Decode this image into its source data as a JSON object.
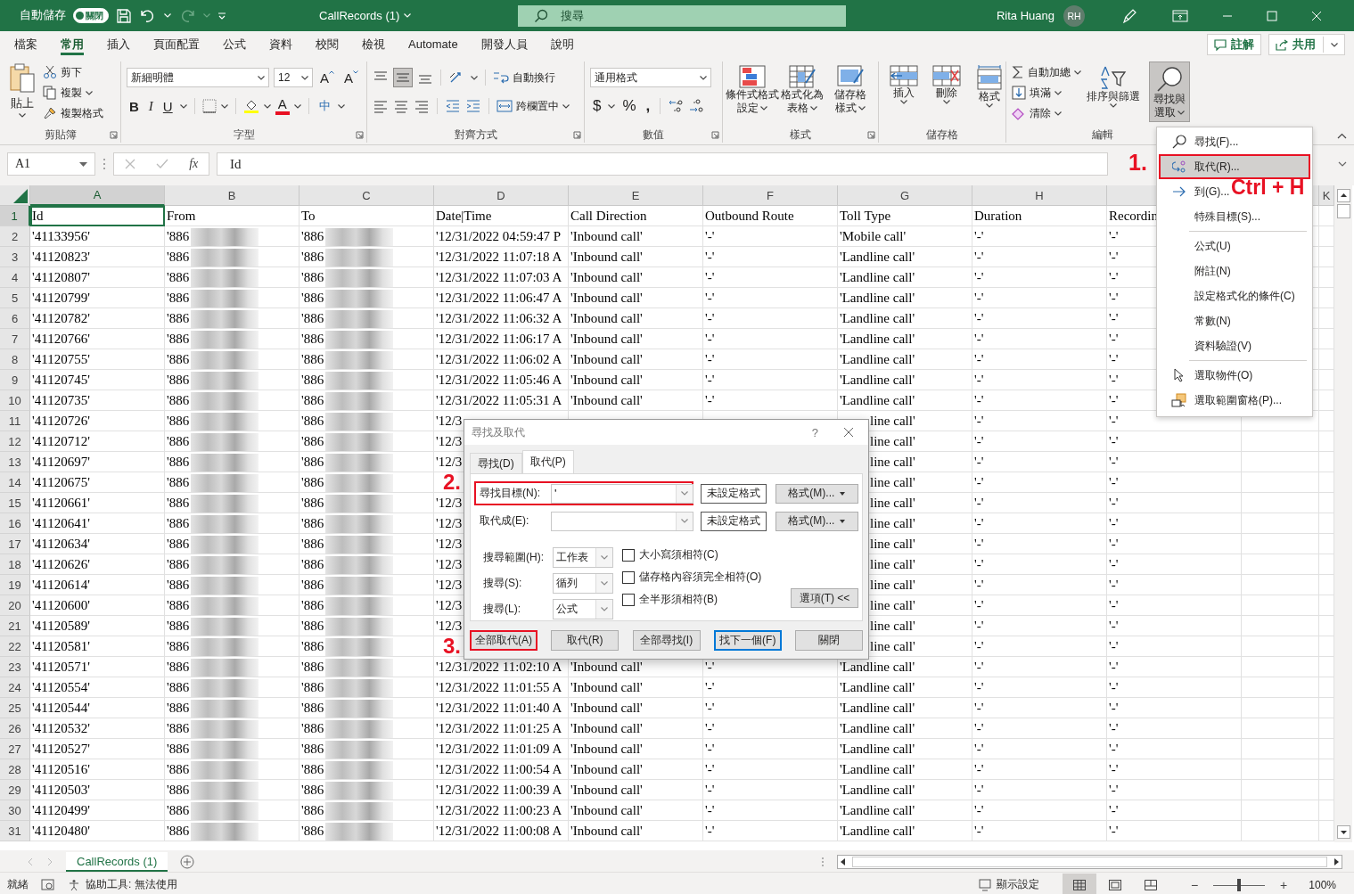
{
  "title_bar": {
    "autosave_label": "自動儲存",
    "autosave_on": false,
    "autosave_state": "關閉",
    "title": "CallRecords (1)",
    "search_placeholder": "搜尋",
    "user": "Rita Huang",
    "initials": "RH"
  },
  "ribbon_tabs": [
    {
      "label": "檔案",
      "selected": false
    },
    {
      "label": "常用",
      "selected": true
    },
    {
      "label": "插入",
      "selected": false
    },
    {
      "label": "頁面配置",
      "selected": false
    },
    {
      "label": "公式",
      "selected": false
    },
    {
      "label": "資料",
      "selected": false
    },
    {
      "label": "校閱",
      "selected": false
    },
    {
      "label": "檢視",
      "selected": false
    },
    {
      "label": "Automate",
      "selected": false
    },
    {
      "label": "開發人員",
      "selected": false
    },
    {
      "label": "說明",
      "selected": false
    }
  ],
  "comments_button": "註解",
  "share_button": "共用",
  "ribbon": {
    "clipboard": {
      "label": "剪貼簿",
      "paste": "貼上",
      "cut": "剪下",
      "copy": "複製",
      "format_painter": "複製格式"
    },
    "font": {
      "label": "字型",
      "font_name": "新細明體",
      "font_size": "12",
      "grow": "A",
      "shrink": "A",
      "bold": "B",
      "italic": "I",
      "underline": "U",
      "font_color": "A",
      "phonetic": "中"
    },
    "alignment": {
      "label": "對齊方式",
      "middle_aligned": true,
      "wrap_text": "自動換行",
      "merge_center": "跨欄置中"
    },
    "number": {
      "label": "數值",
      "format": "通用格式",
      "currency": "$",
      "percent": "%",
      "comma": ","
    },
    "styles": {
      "label": "樣式",
      "buttons": [
        {
          "kind": "conditional",
          "lines": [
            "條件式格式",
            "設定"
          ]
        },
        {
          "kind": "table",
          "lines": [
            "格式化為",
            "表格"
          ]
        },
        {
          "kind": "cellstyle",
          "lines": [
            "儲存格",
            "樣式"
          ]
        }
      ]
    },
    "cells": {
      "label": "儲存格",
      "buttons": [
        {
          "kind": "insert",
          "label": "插入"
        },
        {
          "kind": "delete",
          "label": "刪除"
        },
        {
          "kind": "format",
          "label": "格式"
        }
      ]
    },
    "editing": {
      "label": "編輯",
      "autosum": "自動加總",
      "fill": "填滿",
      "clear": "清除",
      "sort_filter": "排序與篩選",
      "find_select": [
        "尋找與",
        "選取"
      ],
      "find_select_pressed": true
    }
  },
  "sheet": {
    "name_box": "A1",
    "fx": "fx",
    "formula": "Id",
    "columns": [
      {
        "letter": "A",
        "selected": true
      },
      {
        "letter": "B",
        "selected": false
      },
      {
        "letter": "C",
        "selected": false
      },
      {
        "letter": "D",
        "selected": false
      },
      {
        "letter": "E",
        "selected": false
      },
      {
        "letter": "F",
        "selected": false
      },
      {
        "letter": "G",
        "selected": false
      },
      {
        "letter": "H",
        "selected": false
      }
    ],
    "last_column": "K",
    "rows": [
      {
        "n": "1",
        "selected": true,
        "cells": [
          "Id",
          "From",
          "To",
          "Date|Time",
          "Call Direction",
          "Outbound Route",
          "Toll Type",
          "Duration",
          "Recordin"
        ]
      },
      {
        "n": "2",
        "selected": false,
        "cells": [
          "'41133956'",
          "'886",
          "'886",
          "'12/31/2022 04:59:47 P",
          "'Inbound call'",
          "'-'",
          "'Mobile call'",
          "'-'",
          "'-'"
        ]
      },
      {
        "n": "3",
        "selected": false,
        "cells": [
          "'41120823'",
          "'886",
          "'886",
          "'12/31/2022 11:07:18 A",
          "'Inbound call'",
          "'-'",
          "'Landline call'",
          "'-'",
          "'-'"
        ]
      },
      {
        "n": "4",
        "selected": false,
        "cells": [
          "'41120807'",
          "'886",
          "'886",
          "'12/31/2022 11:07:03 A",
          "'Inbound call'",
          "'-'",
          "'Landline call'",
          "'-'",
          "'-'"
        ]
      },
      {
        "n": "5",
        "selected": false,
        "cells": [
          "'41120799'",
          "'886",
          "'886",
          "'12/31/2022 11:06:47 A",
          "'Inbound call'",
          "'-'",
          "'Landline call'",
          "'-'",
          "'-'"
        ]
      },
      {
        "n": "6",
        "selected": false,
        "cells": [
          "'41120782'",
          "'886",
          "'886",
          "'12/31/2022 11:06:32 A",
          "'Inbound call'",
          "'-'",
          "'Landline call'",
          "'-'",
          "'-'"
        ]
      },
      {
        "n": "7",
        "selected": false,
        "cells": [
          "'41120766'",
          "'886",
          "'886",
          "'12/31/2022 11:06:17 A",
          "'Inbound call'",
          "'-'",
          "'Landline call'",
          "'-'",
          "'-'"
        ]
      },
      {
        "n": "8",
        "selected": false,
        "cells": [
          "'41120755'",
          "'886",
          "'886",
          "'12/31/2022 11:06:02 A",
          "'Inbound call'",
          "'-'",
          "'Landline call'",
          "'-'",
          "'-'"
        ]
      },
      {
        "n": "9",
        "selected": false,
        "cells": [
          "'41120745'",
          "'886",
          "'886",
          "'12/31/2022 11:05:46 A",
          "'Inbound call'",
          "'-'",
          "'Landline call'",
          "'-'",
          "'-'"
        ]
      },
      {
        "n": "10",
        "selected": false,
        "cells": [
          "'41120735'",
          "'886",
          "'886",
          "'12/31/2022 11:05:31 A",
          "'Inbound call'",
          "'-'",
          "'Landline call'",
          "'-'",
          "'-'"
        ]
      },
      {
        "n": "11",
        "selected": false,
        "cells": [
          "'41120726'",
          "'886",
          "'886",
          "'12/3",
          null,
          null,
          "line call'",
          "'-'",
          "'-'"
        ]
      },
      {
        "n": "12",
        "selected": false,
        "cells": [
          "'41120712'",
          "'886",
          "'886",
          "'12/3",
          null,
          null,
          "line call'",
          "'-'",
          "'-'"
        ]
      },
      {
        "n": "13",
        "selected": false,
        "cells": [
          "'41120697'",
          "'886",
          "'886",
          "'12/3",
          null,
          null,
          "line call'",
          "'-'",
          "'-'"
        ]
      },
      {
        "n": "14",
        "selected": false,
        "cells": [
          "'41120675'",
          "'886",
          "'886",
          null,
          null,
          null,
          "line call'",
          "'-'",
          "'-'"
        ]
      },
      {
        "n": "15",
        "selected": false,
        "cells": [
          "'41120661'",
          "'886",
          "'886",
          "'12/3",
          null,
          null,
          "line call'",
          "'-'",
          "'-'"
        ]
      },
      {
        "n": "16",
        "selected": false,
        "cells": [
          "'41120641'",
          "'886",
          "'886",
          "'12/3",
          null,
          null,
          "line call'",
          "'-'",
          "'-'"
        ]
      },
      {
        "n": "17",
        "selected": false,
        "cells": [
          "'41120634'",
          "'886",
          "'886",
          "'12/3",
          null,
          null,
          "line call'",
          "'-'",
          "'-'"
        ]
      },
      {
        "n": "18",
        "selected": false,
        "cells": [
          "'41120626'",
          "'886",
          "'886",
          "'12/3",
          null,
          null,
          "line call'",
          "'-'",
          "'-'"
        ]
      },
      {
        "n": "19",
        "selected": false,
        "cells": [
          "'41120614'",
          "'886",
          "'886",
          "'12/3",
          null,
          null,
          "line call'",
          "'-'",
          "'-'"
        ]
      },
      {
        "n": "20",
        "selected": false,
        "cells": [
          "'41120600'",
          "'886",
          "'886",
          "'12/3",
          null,
          null,
          "line call'",
          "'-'",
          "'-'"
        ]
      },
      {
        "n": "21",
        "selected": false,
        "cells": [
          "'41120589'",
          "'886",
          "'886",
          "'12/3",
          null,
          null,
          "line call'",
          "'-'",
          "'-'"
        ]
      },
      {
        "n": "22",
        "selected": false,
        "cells": [
          "'41120581'",
          "'886",
          "'886",
          null,
          null,
          null,
          "line call'",
          "'-'",
          "'-'"
        ]
      },
      {
        "n": "23",
        "selected": false,
        "cells": [
          "'41120571'",
          "'886",
          "'886",
          "'12/31/2022 11:02:10 A",
          "'Inbound call'",
          "'-'",
          "'Landline call'",
          "'-'",
          "'-'"
        ]
      },
      {
        "n": "24",
        "selected": false,
        "cells": [
          "'41120554'",
          "'886",
          "'886",
          "'12/31/2022 11:01:55 A",
          "'Inbound call'",
          "'-'",
          "'Landline call'",
          "'-'",
          "'-'"
        ]
      },
      {
        "n": "25",
        "selected": false,
        "cells": [
          "'41120544'",
          "'886",
          "'886",
          "'12/31/2022 11:01:40 A",
          "'Inbound call'",
          "'-'",
          "'Landline call'",
          "'-'",
          "'-'"
        ]
      },
      {
        "n": "26",
        "selected": false,
        "cells": [
          "'41120532'",
          "'886",
          "'886",
          "'12/31/2022 11:01:25 A",
          "'Inbound call'",
          "'-'",
          "'Landline call'",
          "'-'",
          "'-'"
        ]
      },
      {
        "n": "27",
        "selected": false,
        "cells": [
          "'41120527'",
          "'886",
          "'886",
          "'12/31/2022 11:01:09 A",
          "'Inbound call'",
          "'-'",
          "'Landline call'",
          "'-'",
          "'-'"
        ]
      },
      {
        "n": "28",
        "selected": false,
        "cells": [
          "'41120516'",
          "'886",
          "'886",
          "'12/31/2022 11:00:54 A",
          "'Inbound call'",
          "'-'",
          "'Landline call'",
          "'-'",
          "'-'"
        ]
      },
      {
        "n": "29",
        "selected": false,
        "cells": [
          "'41120503'",
          "'886",
          "'886",
          "'12/31/2022 11:00:39 A",
          "'Inbound call'",
          "'-'",
          "'Landline call'",
          "'-'",
          "'-'"
        ]
      },
      {
        "n": "30",
        "selected": false,
        "cells": [
          "'41120499'",
          "'886",
          "'886",
          "'12/31/2022 11:00:23 A",
          "'Inbound call'",
          "'-'",
          "'Landline call'",
          "'-'",
          "'-'"
        ]
      },
      {
        "n": "31",
        "selected": false,
        "cells": [
          "'41120480'",
          "'886",
          "'886",
          "'12/31/2022 11:00:08 A",
          "'Inbound call'",
          "'-'",
          "'Landline call'",
          "'-'",
          "'-'"
        ]
      }
    ]
  },
  "find_select_menu": {
    "sections": [
      [
        {
          "label": "尋找(F)...",
          "kind": "search",
          "selected": false,
          "annotated": false
        },
        {
          "label": "取代(R)...",
          "kind": "replace",
          "selected": true,
          "annotated": true
        },
        {
          "label": "到(G)...",
          "kind": "goto",
          "selected": false,
          "annotated": false
        },
        {
          "label": "特殊目標(S)...",
          "kind": "plain",
          "selected": false,
          "annotated": false
        }
      ],
      [
        {
          "label": "公式(U)",
          "kind": "plain",
          "selected": false,
          "annotated": false
        },
        {
          "label": "附註(N)",
          "kind": "plain",
          "selected": false,
          "annotated": false
        },
        {
          "label": "設定格式化的條件(C)",
          "kind": "plain",
          "selected": false,
          "annotated": false
        },
        {
          "label": "常數(N)",
          "kind": "plain",
          "selected": false,
          "annotated": false
        },
        {
          "label": "資料驗證(V)",
          "kind": "plain",
          "selected": false,
          "annotated": false
        }
      ],
      [
        {
          "label": "選取物件(O)",
          "kind": "objects",
          "selected": false,
          "annotated": false
        },
        {
          "label": "選取範圍窗格(P)...",
          "kind": "pane",
          "selected": false,
          "annotated": false
        }
      ]
    ]
  },
  "find_replace_dialog": {
    "title": "尋找及取代",
    "help": "?",
    "tabs": [
      {
        "label": "尋找(D)",
        "selected": false
      },
      {
        "label": "取代(P)",
        "selected": true
      }
    ],
    "find_label": "尋找目標(N):",
    "find_value": "'",
    "find_annotated": true,
    "replace_label": "取代成(E):",
    "no_format": [
      "未設定格式",
      "未設定格式"
    ],
    "format_buttons": [
      "格式(M)...",
      "格式(M)..."
    ],
    "options": [
      {
        "label": "搜尋範圍(H):",
        "value": "工作表"
      },
      {
        "label": "搜尋(S):",
        "value": "循列"
      },
      {
        "label": "搜尋(L):",
        "value": "公式"
      }
    ],
    "checkboxes": [
      {
        "label": "大小寫須相符(C)",
        "checked": false
      },
      {
        "label": "儲存格內容須完全相符(O)",
        "checked": false
      },
      {
        "label": "全半形須相符(B)",
        "checked": false
      }
    ],
    "options_button": "選項(T) <<",
    "buttons": [
      {
        "label": "全部取代(A)",
        "default": false,
        "annotated": true
      },
      {
        "label": "取代(R)",
        "default": false,
        "annotated": false
      },
      {
        "label": "全部尋找(I)",
        "default": false,
        "annotated": false
      },
      {
        "label": "找下一個(F)",
        "default": true,
        "annotated": false
      },
      {
        "label": "關閉",
        "default": false,
        "annotated": false
      }
    ]
  },
  "annotations": [
    {
      "text": "1."
    },
    {
      "text": "Ctrl + H"
    },
    {
      "text": "2."
    },
    {
      "text": "3."
    }
  ],
  "sheet_tabs": [
    {
      "label": "CallRecords (1)",
      "selected": true
    }
  ],
  "status_bar": {
    "ready": "就緒",
    "accessibility": "協助工具: 無法使用",
    "display_settings": "顯示設定",
    "views": [
      {
        "kind": "normal",
        "selected": true
      },
      {
        "kind": "page_layout",
        "selected": false
      },
      {
        "kind": "page_break",
        "selected": false
      }
    ],
    "zoom_minus": "−",
    "zoom_plus": "+",
    "zoom": {
      "level": 0.5
    },
    "zoom_text": "100%"
  }
}
